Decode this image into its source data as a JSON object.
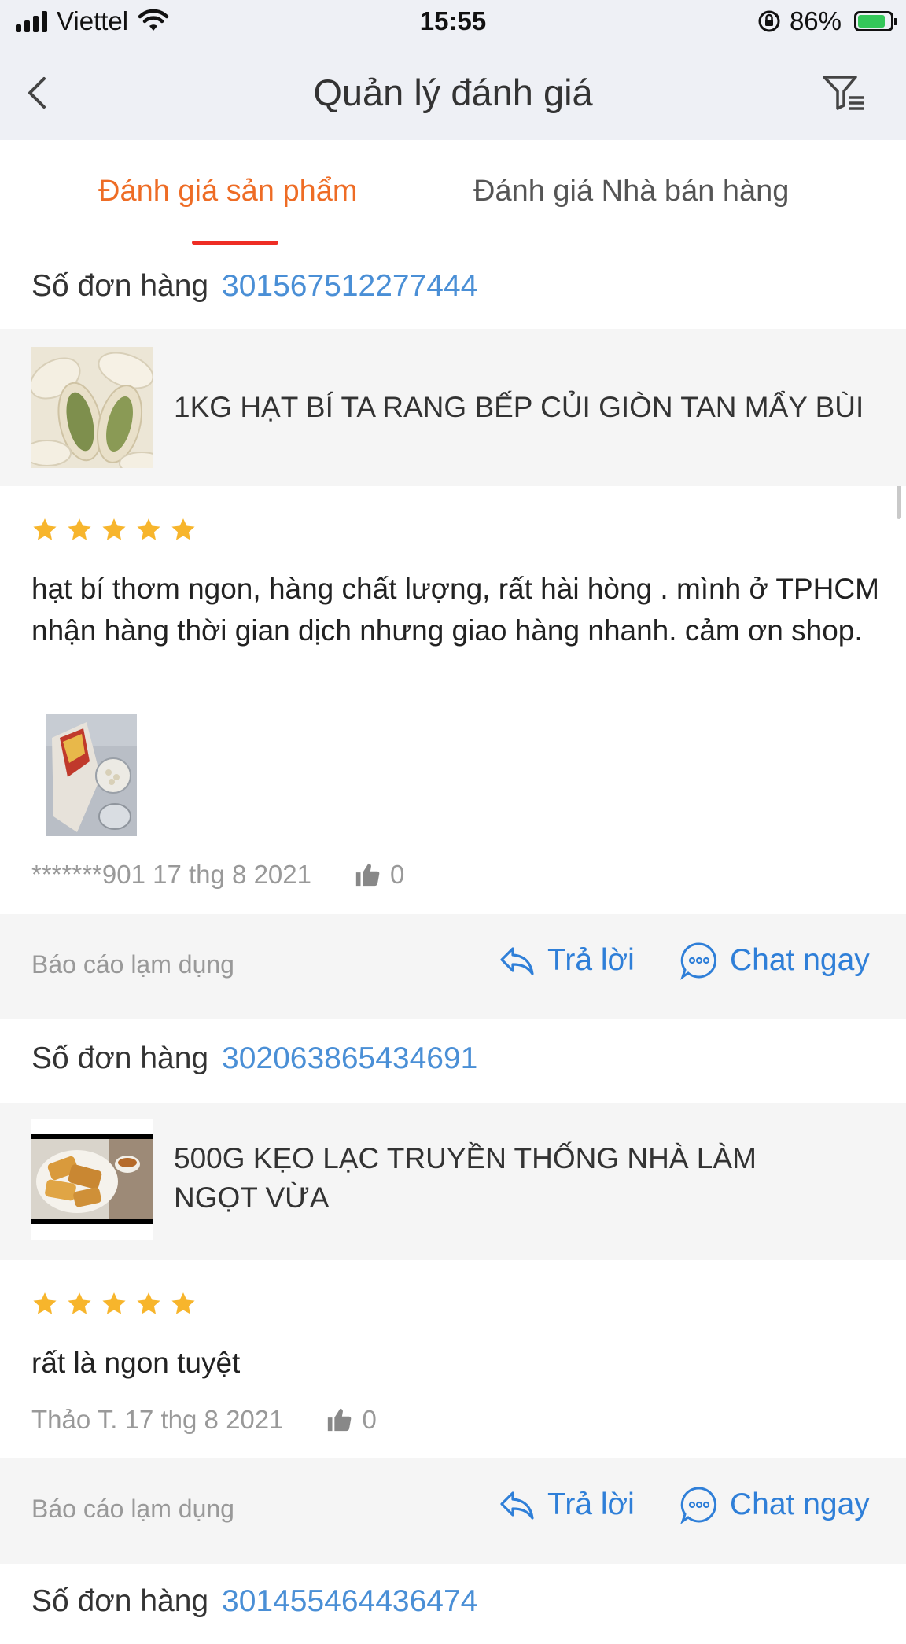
{
  "status_bar": {
    "carrier": "Viettel",
    "time": "15:55",
    "battery": "86%",
    "battery_level": 0.86,
    "icons": [
      "signal-icon",
      "wifi-icon",
      "rotation-lock-icon",
      "battery-charging-icon"
    ]
  },
  "nav": {
    "title": "Quản lý đánh giá",
    "back_icon": "chevron-left-icon",
    "filter_icon": "filter-icon"
  },
  "tabs": [
    {
      "label": "Đánh giá sản phẩm",
      "active": true
    },
    {
      "label": "Đánh giá Nhà bán hàng",
      "active": false
    }
  ],
  "colors": {
    "accent": "#ee6c25",
    "tab_underline": "#ee2d24",
    "link": "#2f7fd8",
    "order_number": "#4a8fd6",
    "star": "#f7b52c"
  },
  "reviews": [
    {
      "order_label": "Số đơn hàng",
      "order_number": "301567512277444",
      "product_name": "1KG HẠT BÍ TA RANG BẾP CỦI GIÒN TAN MẨY BÙI",
      "rating": 5,
      "text": "hạt bí thơm ngon,  hàng chất lượng, rất hài hòng . mình ở TPHCM nhận hàng thời gian dịch nhưng giao hàng nhanh. cảm ơn shop.",
      "has_photo": true,
      "reviewer_date": "*******901 17 thg 8 2021",
      "likes": "0",
      "report_label": "Báo cáo lạm dụng",
      "reply_label": "Trả lời",
      "chat_label": "Chat ngay"
    },
    {
      "order_label": "Số đơn hàng",
      "order_number": "302063865434691",
      "product_name": "500G KẸO LẠC TRUYỀN THỐNG NHÀ LÀM NGỌT VỪA",
      "rating": 5,
      "text": "rất là ngon tuyệt",
      "has_photo": false,
      "reviewer_date": "Thảo T. 17 thg 8 2021",
      "likes": "0",
      "report_label": "Báo cáo lạm dụng",
      "reply_label": "Trả lời",
      "chat_label": "Chat ngay"
    },
    {
      "order_label": "Số đơn hàng",
      "order_number": "301455464436474"
    }
  ]
}
